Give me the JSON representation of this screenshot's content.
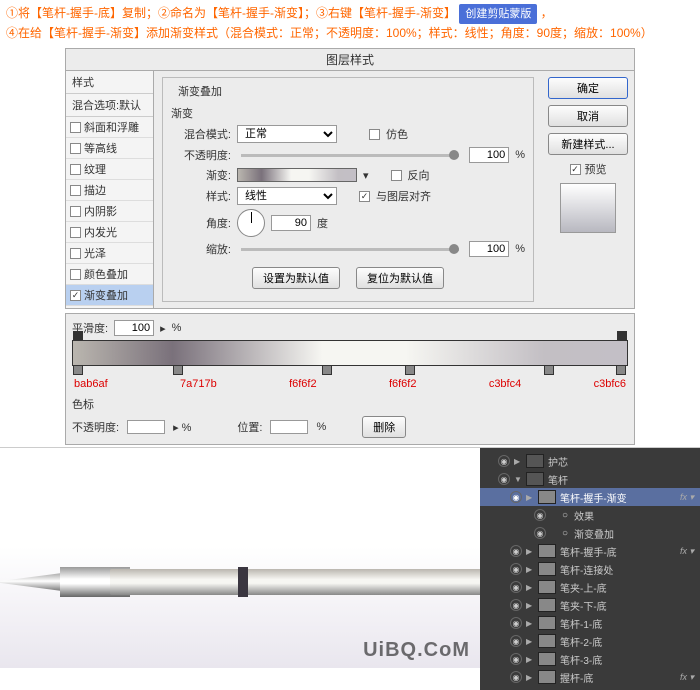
{
  "instructions": {
    "line1_a": "①将【笔杆-握手-底】复制；②命名为【笔杆-握手-渐变】；③右键【笔杆-握手-渐变】",
    "clip_btn": "创建剪贴蒙版",
    "line1_b": "，",
    "line2": "④在给【笔杆-握手-渐变】添加渐变样式（混合模式：正常；不透明度：100%；样式：线性；角度：90度；缩放：100%）"
  },
  "dialog": {
    "title": "图层样式",
    "sidebar_hdr": "样式",
    "blend_default": "混合选项:默认",
    "items": [
      {
        "label": "斜面和浮雕",
        "checked": false
      },
      {
        "label": "等高线",
        "checked": false
      },
      {
        "label": "纹理",
        "checked": false
      },
      {
        "label": "描边",
        "checked": false
      },
      {
        "label": "内阴影",
        "checked": false
      },
      {
        "label": "内发光",
        "checked": false
      },
      {
        "label": "光泽",
        "checked": false
      },
      {
        "label": "颜色叠加",
        "checked": false
      },
      {
        "label": "渐变叠加",
        "checked": true,
        "selected": true
      }
    ],
    "group_title": "渐变叠加",
    "sub_title": "渐变",
    "blend_mode_lbl": "混合模式:",
    "blend_mode_val": "正常",
    "dither_lbl": "仿色",
    "opacity_lbl": "不透明度:",
    "opacity_val": "100",
    "pct": "%",
    "grad_lbl": "渐变:",
    "reverse_lbl": "反向",
    "style_lbl": "样式:",
    "style_val": "线性",
    "align_lbl": "与图层对齐",
    "angle_lbl": "角度:",
    "angle_val": "90",
    "deg": "度",
    "scale_lbl": "缩放:",
    "scale_val": "100",
    "set_default": "设置为默认值",
    "reset_default": "复位为默认值",
    "ok": "确定",
    "cancel": "取消",
    "new_style": "新建样式...",
    "preview_lbl": "预览"
  },
  "grad_editor": {
    "smooth_lbl": "平滑度:",
    "smooth_val": "100",
    "pct": "%",
    "stops": [
      "bab6af",
      "7a717b",
      "f6f6f2",
      "f6f6f2",
      "c3bfc4",
      "c3bfc6"
    ],
    "section": "色标",
    "opac_lbl": "不透明度:",
    "pos_lbl": "位置:",
    "del": "删除"
  },
  "layers": {
    "items": [
      {
        "label": "护芯",
        "indent": 1,
        "folder": true
      },
      {
        "label": "笔杆",
        "indent": 1,
        "folder": true,
        "open": true
      },
      {
        "label": "笔杆-握手-渐变",
        "indent": 2,
        "sel": true,
        "fx": true
      },
      {
        "label": "效果",
        "indent": 4,
        "sub": true
      },
      {
        "label": "渐变叠加",
        "indent": 4,
        "sub": true
      },
      {
        "label": "笔杆-握手-底",
        "indent": 2,
        "fx": true
      },
      {
        "label": "笔杆-连接处",
        "indent": 2
      },
      {
        "label": "笔夹-上-底",
        "indent": 2
      },
      {
        "label": "笔夹-下-底",
        "indent": 2
      },
      {
        "label": "笔杆-1-底",
        "indent": 2
      },
      {
        "label": "笔杆-2-底",
        "indent": 2
      },
      {
        "label": "笔杆-3-底",
        "indent": 2
      },
      {
        "label": "握杆-底",
        "indent": 2,
        "fx": true
      }
    ]
  },
  "watermark": "UiBQ.CoM"
}
